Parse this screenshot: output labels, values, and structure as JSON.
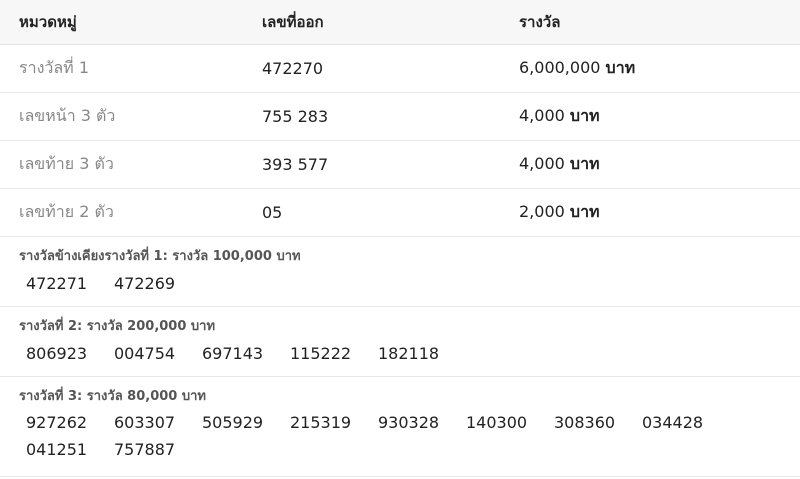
{
  "table": {
    "headers": {
      "category": "หมวดหมู่",
      "number": "เลขที่ออก",
      "prize": "รางวัล"
    },
    "rows": [
      {
        "category": "รางวัลที่ 1",
        "number": "472270",
        "amount": "6,000,000",
        "unit": "บาท"
      },
      {
        "category": "เลขหน้า 3 ตัว",
        "number": "755 283",
        "amount": "4,000",
        "unit": "บาท"
      },
      {
        "category": "เลขท้าย 3 ตัว",
        "number": "393 577",
        "amount": "4,000",
        "unit": "บาท"
      },
      {
        "category": "เลขท้าย 2 ตัว",
        "number": "05",
        "amount": "2,000",
        "unit": "บาท"
      }
    ]
  },
  "groups": [
    {
      "title": "รางวัลข้างเคียงรางวัลที่ 1: รางวัล 100,000 บาท",
      "numbers": [
        "472271",
        "472269"
      ]
    },
    {
      "title": "รางวัลที่ 2: รางวัล 200,000 บาท",
      "numbers": [
        "806923",
        "004754",
        "697143",
        "115222",
        "182118"
      ]
    },
    {
      "title": "รางวัลที่ 3: รางวัล 80,000 บาท",
      "numbers": [
        "927262",
        "603307",
        "505929",
        "215319",
        "930328",
        "140300",
        "308360",
        "034428",
        "041251",
        "757887"
      ]
    }
  ]
}
